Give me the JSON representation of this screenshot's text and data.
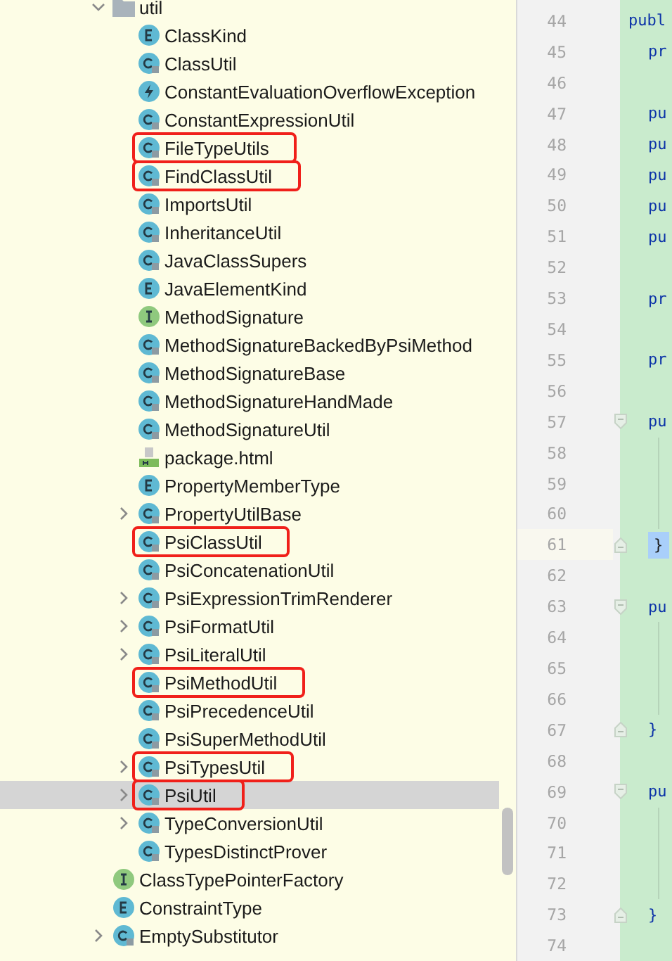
{
  "tree": [
    {
      "name": "util",
      "kind": "folder",
      "expanded": true,
      "selected": false,
      "highlighted": false,
      "children": [
        {
          "name": "ClassKind",
          "kind": "enum",
          "selected": false,
          "highlighted": false
        },
        {
          "name": "ClassUtil",
          "kind": "class",
          "selected": false,
          "highlighted": false
        },
        {
          "name": "ConstantEvaluationOverflowException",
          "kind": "exception",
          "selected": false,
          "highlighted": false
        },
        {
          "name": "ConstantExpressionUtil",
          "kind": "class",
          "selected": false,
          "highlighted": false
        },
        {
          "name": "FileTypeUtils",
          "kind": "class",
          "selected": false,
          "highlighted": true
        },
        {
          "name": "FindClassUtil",
          "kind": "class",
          "selected": false,
          "highlighted": true
        },
        {
          "name": "ImportsUtil",
          "kind": "class",
          "selected": false,
          "highlighted": false
        },
        {
          "name": "InheritanceUtil",
          "kind": "class",
          "selected": false,
          "highlighted": false
        },
        {
          "name": "JavaClassSupers",
          "kind": "class",
          "selected": false,
          "highlighted": false
        },
        {
          "name": "JavaElementKind",
          "kind": "enum",
          "selected": false,
          "highlighted": false
        },
        {
          "name": "MethodSignature",
          "kind": "interface",
          "selected": false,
          "highlighted": false
        },
        {
          "name": "MethodSignatureBackedByPsiMethod",
          "kind": "class",
          "selected": false,
          "highlighted": false
        },
        {
          "name": "MethodSignatureBase",
          "kind": "class",
          "selected": false,
          "highlighted": false
        },
        {
          "name": "MethodSignatureHandMade",
          "kind": "class",
          "selected": false,
          "highlighted": false
        },
        {
          "name": "MethodSignatureUtil",
          "kind": "class",
          "selected": false,
          "highlighted": false
        },
        {
          "name": "package.html",
          "kind": "html",
          "selected": false,
          "highlighted": false
        },
        {
          "name": "PropertyMemberType",
          "kind": "enum",
          "selected": false,
          "highlighted": false
        },
        {
          "name": "PropertyUtilBase",
          "kind": "class",
          "expanded": false,
          "selected": false,
          "highlighted": false
        },
        {
          "name": "PsiClassUtil",
          "kind": "class",
          "selected": false,
          "highlighted": true
        },
        {
          "name": "PsiConcatenationUtil",
          "kind": "class",
          "selected": false,
          "highlighted": false
        },
        {
          "name": "PsiExpressionTrimRenderer",
          "kind": "class",
          "expanded": false,
          "selected": false,
          "highlighted": false
        },
        {
          "name": "PsiFormatUtil",
          "kind": "class",
          "expanded": false,
          "selected": false,
          "highlighted": false
        },
        {
          "name": "PsiLiteralUtil",
          "kind": "class",
          "expanded": false,
          "selected": false,
          "highlighted": false
        },
        {
          "name": "PsiMethodUtil",
          "kind": "class",
          "selected": false,
          "highlighted": true
        },
        {
          "name": "PsiPrecedenceUtil",
          "kind": "class",
          "selected": false,
          "highlighted": false
        },
        {
          "name": "PsiSuperMethodUtil",
          "kind": "class",
          "selected": false,
          "highlighted": false
        },
        {
          "name": "PsiTypesUtil",
          "kind": "class",
          "expanded": false,
          "selected": false,
          "highlighted": true
        },
        {
          "name": "PsiUtil",
          "kind": "class",
          "expanded": false,
          "selected": true,
          "highlighted": true
        },
        {
          "name": "TypeConversionUtil",
          "kind": "class",
          "expanded": false,
          "selected": false,
          "highlighted": false
        },
        {
          "name": "TypesDistinctProver",
          "kind": "class",
          "selected": false,
          "highlighted": false
        }
      ]
    },
    {
      "name": "ClassTypePointerFactory",
      "kind": "interface",
      "selected": false,
      "highlighted": false
    },
    {
      "name": "ConstraintType",
      "kind": "enum",
      "selected": false,
      "highlighted": false
    },
    {
      "name": "EmptySubstitutor",
      "kind": "class",
      "expanded": false,
      "selected": false,
      "highlighted": false
    }
  ],
  "editor": {
    "lines": [
      {
        "number": "44",
        "text": "publ",
        "kind": "declaration"
      },
      {
        "number": "45",
        "text": "pr",
        "kind": "member"
      },
      {
        "number": "46"
      },
      {
        "number": "47",
        "text": "pu",
        "kind": "member"
      },
      {
        "number": "48",
        "text": "pu",
        "kind": "member"
      },
      {
        "number": "49",
        "text": "pu",
        "kind": "member"
      },
      {
        "number": "50",
        "text": "pu",
        "kind": "member"
      },
      {
        "number": "51",
        "text": "pu",
        "kind": "member"
      },
      {
        "number": "52"
      },
      {
        "number": "53",
        "text": "pr",
        "kind": "member"
      },
      {
        "number": "54"
      },
      {
        "number": "55",
        "text": "pr",
        "kind": "member"
      },
      {
        "number": "56"
      },
      {
        "number": "57",
        "text": "pu",
        "kind": "member",
        "fold_start": true
      },
      {
        "number": "58",
        "in_fold": true
      },
      {
        "number": "59",
        "in_fold": true
      },
      {
        "number": "60",
        "in_fold": true
      },
      {
        "number": "61",
        "text": "}",
        "kind": "member",
        "current": true,
        "fold_end": true
      },
      {
        "number": "62"
      },
      {
        "number": "63",
        "text": "pu",
        "kind": "member",
        "fold_start": true
      },
      {
        "number": "64",
        "in_fold": true
      },
      {
        "number": "65",
        "in_fold": true
      },
      {
        "number": "66",
        "in_fold": true
      },
      {
        "number": "67",
        "text": "}",
        "kind": "member",
        "fold_end": true
      },
      {
        "number": "68"
      },
      {
        "number": "69",
        "text": "pu",
        "kind": "member",
        "fold_start": true
      },
      {
        "number": "70",
        "in_fold": true
      },
      {
        "number": "71",
        "in_fold": true
      },
      {
        "number": "72",
        "in_fold": true
      },
      {
        "number": "73",
        "text": "}",
        "kind": "member",
        "fold_end": true
      },
      {
        "number": "74"
      }
    ]
  }
}
